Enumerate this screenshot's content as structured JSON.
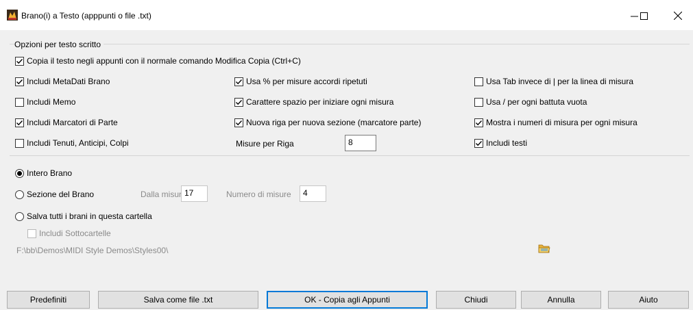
{
  "window": {
    "title": "Brano(i) a Testo (apppunti o file .txt)",
    "icon": "band-in-a-box-app-icon"
  },
  "options_group": {
    "label": "Opzioni per testo scritto",
    "copy_clipboard": {
      "label": "Copia il testo negli appunti con il normale comando Modifica Copia (Ctrl+C)",
      "checked": true
    },
    "col1": [
      {
        "label": "Includi MetaDati Brano",
        "checked": true
      },
      {
        "label": "Includi Memo",
        "checked": false
      },
      {
        "label": "Includi Marcatori di Parte",
        "checked": true
      },
      {
        "label": "Includi Tenuti, Anticipi, Colpi",
        "checked": false
      }
    ],
    "col2": [
      {
        "label": "Usa % per misure accordi ripetuti",
        "checked": true
      },
      {
        "label": "Carattere spazio per iniziare ogni misura",
        "checked": true
      },
      {
        "label": "Nuova riga per nuova sezione (marcatore parte)",
        "checked": true
      }
    ],
    "bars_per_row": {
      "label": "Misure per Riga",
      "value": "8"
    },
    "col3": [
      {
        "label": "Usa Tab invece di | per la linea di misura",
        "checked": false
      },
      {
        "label": "Usa / per ogni battuta vuota",
        "checked": false
      },
      {
        "label": "Mostra i numeri di misura per ogni misura",
        "checked": true
      },
      {
        "label": "Includi testi",
        "checked": true
      }
    ]
  },
  "scope": {
    "whole_song": {
      "label": "Intero Brano",
      "selected": true
    },
    "section": {
      "label": "Sezione del Brano",
      "selected": false
    },
    "from_bar": {
      "label": "Dalla misura",
      "value": "17"
    },
    "num_bars": {
      "label": "Numero di misure",
      "value": "4"
    },
    "folder": {
      "label": "Salva tutti i brani in questa cartella",
      "selected": false
    },
    "subfolders": {
      "label": "Includi Sottocartelle",
      "checked": false
    },
    "path": "F:\\bb\\Demos\\MIDI Style Demos\\Styles00\\"
  },
  "buttons": {
    "defaults": "Predefiniti",
    "save_txt": "Salva come file .txt",
    "ok_copy": "OK - Copia agli Appunti",
    "close": "Chiudi",
    "cancel": "Annulla",
    "help": "Aiuto"
  }
}
